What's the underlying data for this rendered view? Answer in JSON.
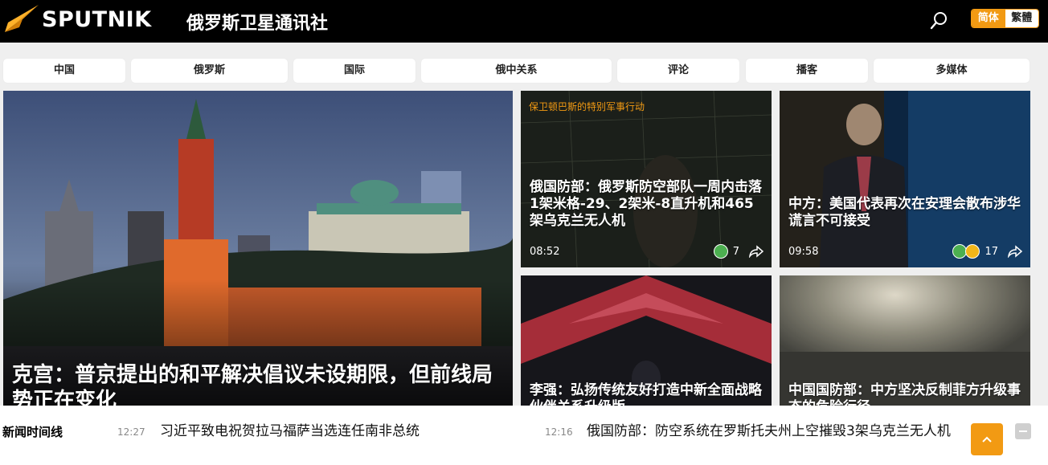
{
  "brand": {
    "logo_text": "SPUTNIK",
    "site_name": "俄罗斯卫星通讯社",
    "accent_color": "#f29a13"
  },
  "header": {
    "search_icon": "search-icon",
    "lang_simplified": "简体",
    "lang_traditional": "繁體"
  },
  "nav": {
    "items": [
      "中国",
      "俄罗斯",
      "国际",
      "俄中关系",
      "评论",
      "播客",
      "多媒体"
    ]
  },
  "featured": {
    "title": "克宫：普京提出的和平解决倡议未设期限，但前线局势正在变化"
  },
  "cards": [
    {
      "overlay_tag": "保卫顿巴斯的特别军事行动",
      "title": "俄国防部：俄罗斯防空部队一周内击落1架米格-29、2架米-8直升机和465架乌克兰无人机",
      "time": "08:52",
      "reactions": "7"
    },
    {
      "title": "中方：美国代表再次在安理会散布涉华谎言不可接受",
      "time": "09:58",
      "reactions": "17"
    },
    {
      "title": "李强：弘扬传统友好打造中新全面战略伙伴关系升级版"
    },
    {
      "title": "中国国防部：中方坚决反制菲方升级事态的危险行径"
    }
  ],
  "timeline": {
    "label": "新闻时间线",
    "items": [
      {
        "time": "12:27",
        "text": "习近平致电祝贺拉马福萨当选连任南非总统"
      },
      {
        "time": "12:16",
        "text": "俄国防部：防空系统在罗斯托夫州上空摧毁3架乌克兰无人机"
      }
    ]
  }
}
